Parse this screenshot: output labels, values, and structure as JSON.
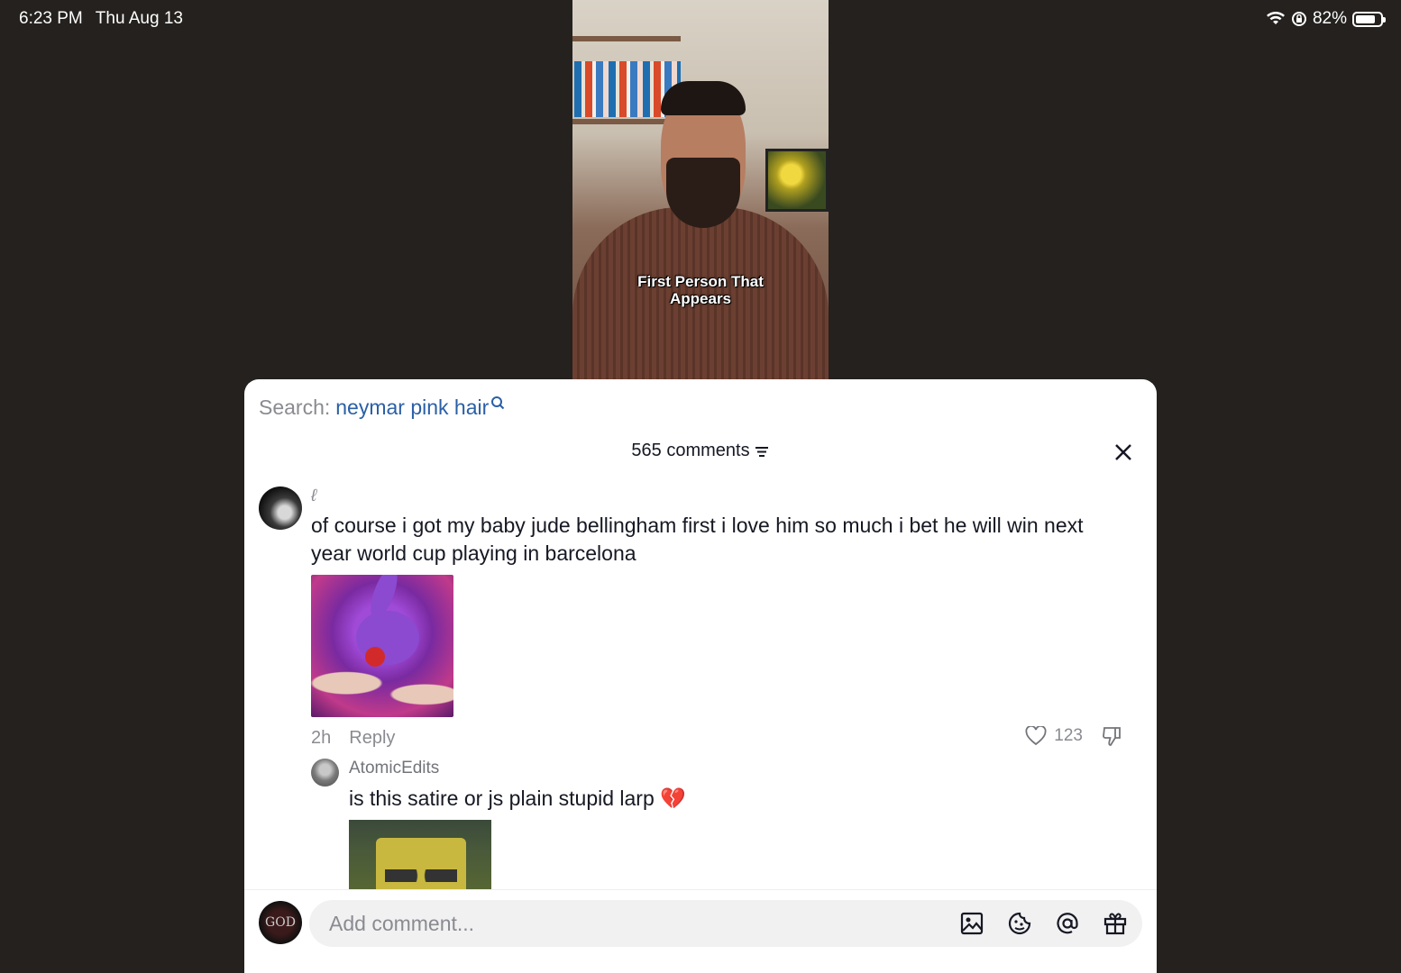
{
  "status_bar": {
    "time": "6:23 PM",
    "date": "Thu Aug 13",
    "battery_percent": "82%",
    "battery_level": 0.82,
    "icons": [
      "wifi-icon",
      "rotation-lock-icon",
      "battery-icon"
    ]
  },
  "video": {
    "caption_line1": "First Person That",
    "caption_line2": "Appears"
  },
  "panel": {
    "search_label": "Search:",
    "search_query": "neymar pink hair",
    "comments_count": "565 comments",
    "comments": [
      {
        "username": "ℓ",
        "text": "of course i got my baby jude bellingham first i love him so much i bet he will win next year world cup playing in barcelona",
        "time": "2h",
        "reply_label": "Reply",
        "likes": "123"
      }
    ],
    "replies": [
      {
        "username": "AtomicEdits",
        "text": "is this satire or js plain stupid larp 💔"
      }
    ],
    "input_placeholder": "Add comment...",
    "my_avatar_text": "GOD"
  },
  "colors": {
    "background": "#24211e",
    "link_blue": "#2b5fa6",
    "muted_gray": "#8a8b91",
    "text_dark": "#161823"
  }
}
